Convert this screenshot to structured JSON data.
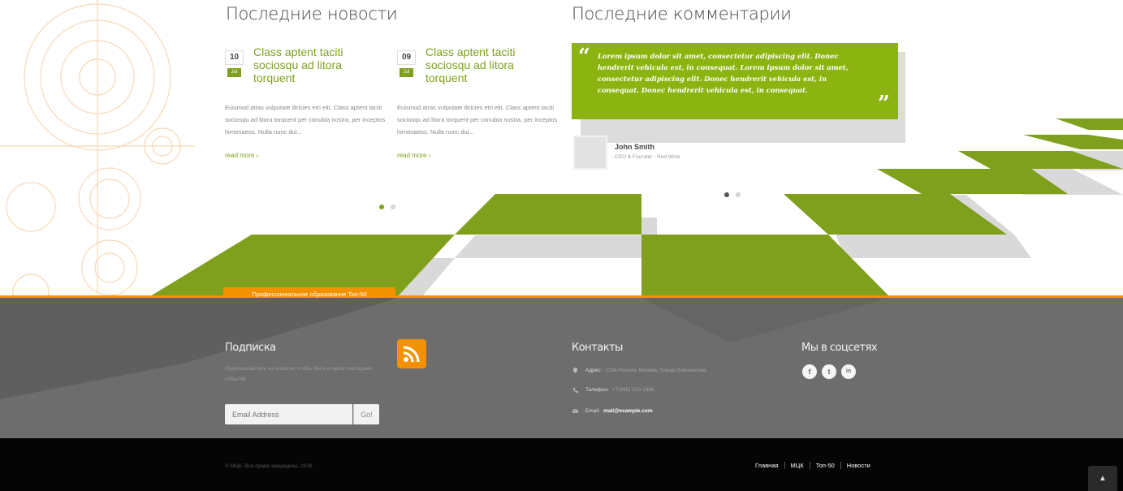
{
  "news": {
    "title": "Последние новости",
    "items": [
      {
        "day": "10",
        "month": "Jul",
        "headline": "Class aptent taciti sociosqu ad litora torquent",
        "excerpt": "Euismod atras vulputate iltricies etri elit. Class aptent taciti sociosqu ad litora torquent per conubia nostra, per inceptos himenaeos. Nulla nunc dui...",
        "read_more": "read more ›"
      },
      {
        "day": "09",
        "month": "Jul",
        "headline": "Class aptent taciti sociosqu ad litora torquent",
        "excerpt": "Euismod atras vulputate iltricies etri elit. Class aptent taciti sociosqu ad litora torquent per conubia nostra, per inceptos himenaeos. Nulla nunc dui...",
        "read_more": "read more ›"
      }
    ]
  },
  "comments": {
    "title": "Последние комментарии",
    "quote": "Lorem ipsum dolor sit amet, consectetur adipiscing elit. Donec hendrerit vehicula est, in consequat. Lorem ipsum dolor sit amet, consectetur adipiscing elit. Donec hendrerit vehicula est, in consequat. Donec hendrerit vehicula est, in consequat.",
    "open_quote": "“",
    "close_quote": "”",
    "author_name": "John Smith",
    "author_role": "CEO & Founder - Red Wine"
  },
  "banner": {
    "badge": "Профессиональное образование Топ-50"
  },
  "footer": {
    "subscribe": {
      "title": "Подписка",
      "text": "Подписывайтесь на новости, чтобы быть в курсе последних событий",
      "email_placeholder": "Email Address",
      "go_label": "Go!"
    },
    "contacts": {
      "title": "Контакты",
      "address_label": "Адрес:",
      "address_value": "1234 Россия, Москва, Улица Ломоносова",
      "phone_label": "Телефон:",
      "phone_value": "+7(495) 010-1996",
      "email_label": "Email:",
      "email_value": "mail@example.com"
    },
    "social": {
      "title": "Мы в соцсетях",
      "icons": [
        "facebook-icon",
        "twitter-icon",
        "linkedin-icon"
      ],
      "facebook_glyph": "f",
      "twitter_glyph": "t",
      "linkedin_glyph": "in"
    }
  },
  "bottom": {
    "copyright": "© МЦК. Все права защищены. 2016",
    "nav": [
      "Главная",
      "МЦК",
      "Топ-50",
      "Новости"
    ],
    "scroll_top": "▲"
  },
  "colors": {
    "accent_green": "#8cb411",
    "accent_orange": "#f39200",
    "footer_gray": "#6d6d6d",
    "footer_black": "#050505"
  }
}
